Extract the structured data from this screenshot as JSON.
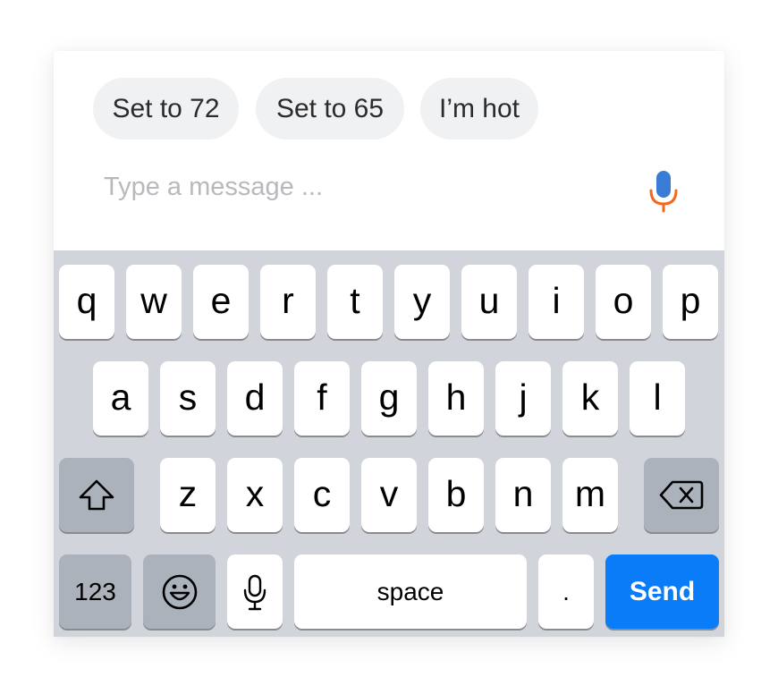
{
  "quick_replies": [
    {
      "label": "Set to 72"
    },
    {
      "label": "Set to 65"
    },
    {
      "label": "I’m hot"
    }
  ],
  "composer": {
    "placeholder": "Type a message ...",
    "value": "",
    "mic_icon": "microphone-icon",
    "mic_colors": {
      "head": "#3a7bd5",
      "stand": "#f26a21"
    }
  },
  "keyboard": {
    "row1": [
      "q",
      "w",
      "e",
      "r",
      "t",
      "y",
      "u",
      "i",
      "o",
      "p"
    ],
    "row2": [
      "a",
      "s",
      "d",
      "f",
      "g",
      "h",
      "j",
      "k",
      "l"
    ],
    "row3": [
      "z",
      "x",
      "c",
      "v",
      "b",
      "n",
      "m"
    ],
    "shift_icon": "shift-arrow-icon",
    "delete_icon": "backspace-icon",
    "numbers_label": "123",
    "emoji_icon": "emoji-smiley-icon",
    "dictation_icon": "microphone-icon",
    "space_label": "space",
    "period_label": ".",
    "send_label": "Send",
    "send_color": "#0a7cf8"
  }
}
